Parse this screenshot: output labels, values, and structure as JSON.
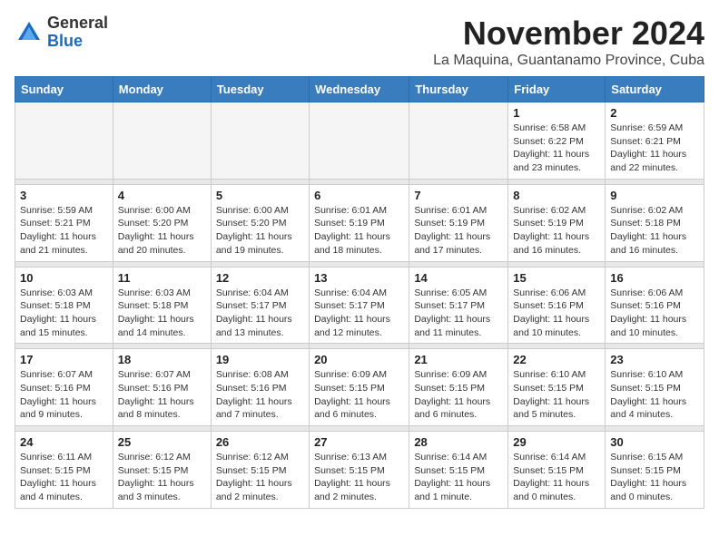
{
  "header": {
    "logo_general": "General",
    "logo_blue": "Blue",
    "month_title": "November 2024",
    "location": "La Maquina, Guantanamo Province, Cuba"
  },
  "days_of_week": [
    "Sunday",
    "Monday",
    "Tuesday",
    "Wednesday",
    "Thursday",
    "Friday",
    "Saturday"
  ],
  "weeks": [
    [
      {
        "day": "",
        "info": ""
      },
      {
        "day": "",
        "info": ""
      },
      {
        "day": "",
        "info": ""
      },
      {
        "day": "",
        "info": ""
      },
      {
        "day": "",
        "info": ""
      },
      {
        "day": "1",
        "info": "Sunrise: 6:58 AM\nSunset: 6:22 PM\nDaylight: 11 hours and 23 minutes."
      },
      {
        "day": "2",
        "info": "Sunrise: 6:59 AM\nSunset: 6:21 PM\nDaylight: 11 hours and 22 minutes."
      }
    ],
    [
      {
        "day": "3",
        "info": "Sunrise: 5:59 AM\nSunset: 5:21 PM\nDaylight: 11 hours and 21 minutes."
      },
      {
        "day": "4",
        "info": "Sunrise: 6:00 AM\nSunset: 5:20 PM\nDaylight: 11 hours and 20 minutes."
      },
      {
        "day": "5",
        "info": "Sunrise: 6:00 AM\nSunset: 5:20 PM\nDaylight: 11 hours and 19 minutes."
      },
      {
        "day": "6",
        "info": "Sunrise: 6:01 AM\nSunset: 5:19 PM\nDaylight: 11 hours and 18 minutes."
      },
      {
        "day": "7",
        "info": "Sunrise: 6:01 AM\nSunset: 5:19 PM\nDaylight: 11 hours and 17 minutes."
      },
      {
        "day": "8",
        "info": "Sunrise: 6:02 AM\nSunset: 5:19 PM\nDaylight: 11 hours and 16 minutes."
      },
      {
        "day": "9",
        "info": "Sunrise: 6:02 AM\nSunset: 5:18 PM\nDaylight: 11 hours and 16 minutes."
      }
    ],
    [
      {
        "day": "10",
        "info": "Sunrise: 6:03 AM\nSunset: 5:18 PM\nDaylight: 11 hours and 15 minutes."
      },
      {
        "day": "11",
        "info": "Sunrise: 6:03 AM\nSunset: 5:18 PM\nDaylight: 11 hours and 14 minutes."
      },
      {
        "day": "12",
        "info": "Sunrise: 6:04 AM\nSunset: 5:17 PM\nDaylight: 11 hours and 13 minutes."
      },
      {
        "day": "13",
        "info": "Sunrise: 6:04 AM\nSunset: 5:17 PM\nDaylight: 11 hours and 12 minutes."
      },
      {
        "day": "14",
        "info": "Sunrise: 6:05 AM\nSunset: 5:17 PM\nDaylight: 11 hours and 11 minutes."
      },
      {
        "day": "15",
        "info": "Sunrise: 6:06 AM\nSunset: 5:16 PM\nDaylight: 11 hours and 10 minutes."
      },
      {
        "day": "16",
        "info": "Sunrise: 6:06 AM\nSunset: 5:16 PM\nDaylight: 11 hours and 10 minutes."
      }
    ],
    [
      {
        "day": "17",
        "info": "Sunrise: 6:07 AM\nSunset: 5:16 PM\nDaylight: 11 hours and 9 minutes."
      },
      {
        "day": "18",
        "info": "Sunrise: 6:07 AM\nSunset: 5:16 PM\nDaylight: 11 hours and 8 minutes."
      },
      {
        "day": "19",
        "info": "Sunrise: 6:08 AM\nSunset: 5:16 PM\nDaylight: 11 hours and 7 minutes."
      },
      {
        "day": "20",
        "info": "Sunrise: 6:09 AM\nSunset: 5:15 PM\nDaylight: 11 hours and 6 minutes."
      },
      {
        "day": "21",
        "info": "Sunrise: 6:09 AM\nSunset: 5:15 PM\nDaylight: 11 hours and 6 minutes."
      },
      {
        "day": "22",
        "info": "Sunrise: 6:10 AM\nSunset: 5:15 PM\nDaylight: 11 hours and 5 minutes."
      },
      {
        "day": "23",
        "info": "Sunrise: 6:10 AM\nSunset: 5:15 PM\nDaylight: 11 hours and 4 minutes."
      }
    ],
    [
      {
        "day": "24",
        "info": "Sunrise: 6:11 AM\nSunset: 5:15 PM\nDaylight: 11 hours and 4 minutes."
      },
      {
        "day": "25",
        "info": "Sunrise: 6:12 AM\nSunset: 5:15 PM\nDaylight: 11 hours and 3 minutes."
      },
      {
        "day": "26",
        "info": "Sunrise: 6:12 AM\nSunset: 5:15 PM\nDaylight: 11 hours and 2 minutes."
      },
      {
        "day": "27",
        "info": "Sunrise: 6:13 AM\nSunset: 5:15 PM\nDaylight: 11 hours and 2 minutes."
      },
      {
        "day": "28",
        "info": "Sunrise: 6:14 AM\nSunset: 5:15 PM\nDaylight: 11 hours and 1 minute."
      },
      {
        "day": "29",
        "info": "Sunrise: 6:14 AM\nSunset: 5:15 PM\nDaylight: 11 hours and 0 minutes."
      },
      {
        "day": "30",
        "info": "Sunrise: 6:15 AM\nSunset: 5:15 PM\nDaylight: 11 hours and 0 minutes."
      }
    ]
  ]
}
